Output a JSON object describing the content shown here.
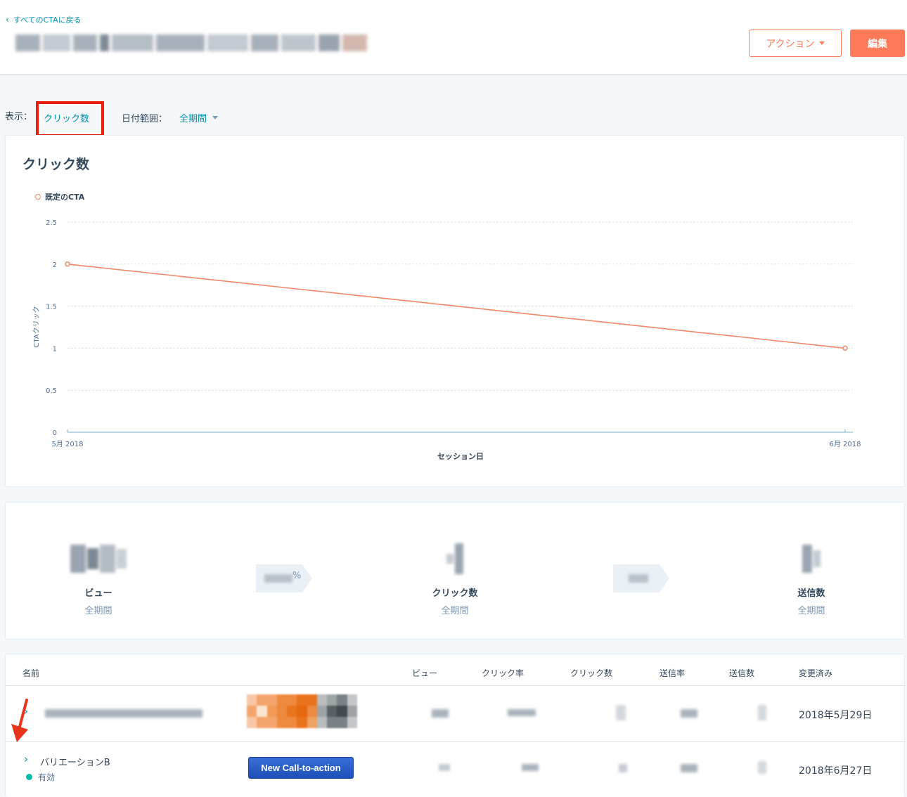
{
  "header": {
    "back_link": "すべてのCTAに戻る",
    "action_button": "アクション",
    "edit_button": "編集"
  },
  "filters": {
    "view_label": "表示：",
    "view_value": "クリック数",
    "date_label": "日付範囲：",
    "date_value": "全期間"
  },
  "chart": {
    "title": "クリック数"
  },
  "chart_data": {
    "type": "line",
    "title": "クリック数",
    "xlabel": "セッション日",
    "ylabel": "CTAクリック",
    "x": [
      "5月 2018",
      "6月 2018"
    ],
    "series": [
      {
        "name": "既定のCTA",
        "values": [
          2,
          1
        ]
      }
    ],
    "ylim": [
      0,
      2.5
    ],
    "yticks": [
      "0",
      "0.5",
      "1",
      "1.5",
      "2",
      "2.5"
    ],
    "grid": true,
    "legend": "top-left",
    "colors": {
      "series": "#f2876a",
      "axis": "#7fb0c4",
      "grid": "#dfe3eb"
    }
  },
  "stats": {
    "views": {
      "label": "ビュー",
      "sub": "全期間"
    },
    "clicks": {
      "label": "クリック数",
      "sub": "全期間"
    },
    "submissions": {
      "label": "送信数",
      "sub": "全期間"
    },
    "rate_suffix": "%"
  },
  "table": {
    "headers": {
      "name": "名前",
      "views": "ビュー",
      "click_rate": "クリック率",
      "clicks": "クリック数",
      "submit_rate": "送信率",
      "submissions": "送信数",
      "modified": "変更済み"
    },
    "rows": [
      {
        "modified": "2018年5月29日"
      },
      {
        "name": "バリエーションB",
        "status": "有効",
        "cta_button": "New Call-to-action",
        "modified": "2018年6月27日"
      }
    ]
  },
  "colors": {
    "accent": "#ff7a59",
    "link": "#0091ae",
    "highlight_box": "#e8200b",
    "status_active": "#00bda5",
    "cta_button": "#1d4fb8"
  }
}
